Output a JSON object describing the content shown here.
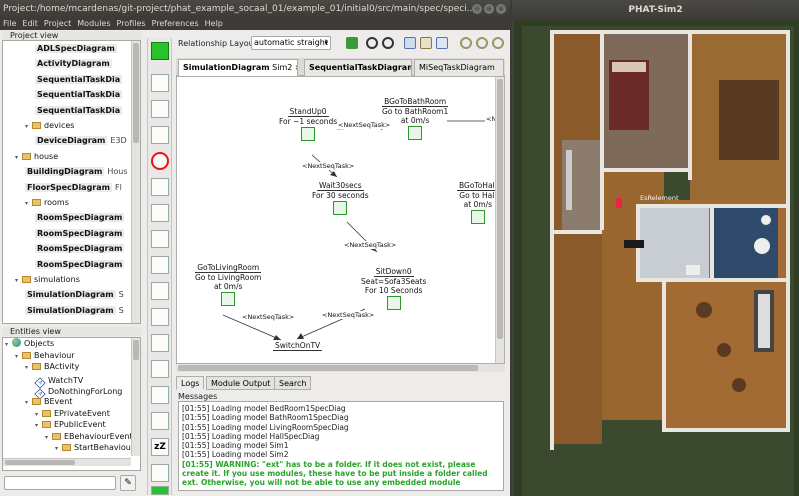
{
  "editor": {
    "title": "Project:/home/mcardenas/git-project/phat_example_socaal_01/example_01/initial0/src/main/spec/speci...",
    "window_buttons": [
      "⊖",
      "⊕",
      "⊗"
    ],
    "menu": [
      "File",
      "Edit",
      "Project",
      "Modules",
      "Profiles",
      "Preferences",
      "Help"
    ]
  },
  "project_view": {
    "title": "Project view",
    "rows": [
      {
        "label": "ADLSpecDiagram",
        "suffix": "",
        "indent": 3,
        "bold": true,
        "icon": "none"
      },
      {
        "label": "ActivityDiagram",
        "suffix": "",
        "indent": 3,
        "bold": true,
        "icon": "none"
      },
      {
        "label": "SequentialTaskDia",
        "suffix": "",
        "indent": 3,
        "bold": true,
        "icon": "none"
      },
      {
        "label": "SequentialTaskDia",
        "suffix": "",
        "indent": 3,
        "bold": true,
        "icon": "none"
      },
      {
        "label": "SequentialTaskDia",
        "suffix": "",
        "indent": 3,
        "bold": true,
        "icon": "none"
      },
      {
        "label": "devices",
        "suffix": "",
        "indent": 2,
        "bold": false,
        "icon": "folder"
      },
      {
        "label": "DeviceDiagram",
        "suffix": "E3D",
        "indent": 3,
        "bold": true,
        "icon": "none"
      },
      {
        "label": "house",
        "suffix": "",
        "indent": 1,
        "bold": false,
        "icon": "folder"
      },
      {
        "label": "BuildingDiagram",
        "suffix": "Hous",
        "indent": 2,
        "bold": true,
        "icon": "none"
      },
      {
        "label": "FloorSpecDiagram",
        "suffix": "Fl",
        "indent": 2,
        "bold": true,
        "icon": "none"
      },
      {
        "label": "rooms",
        "suffix": "",
        "indent": 2,
        "bold": false,
        "icon": "folder"
      },
      {
        "label": "RoomSpecDiagram",
        "suffix": "",
        "indent": 3,
        "bold": true,
        "icon": "none"
      },
      {
        "label": "RoomSpecDiagram",
        "suffix": "",
        "indent": 3,
        "bold": true,
        "icon": "none"
      },
      {
        "label": "RoomSpecDiagram",
        "suffix": "",
        "indent": 3,
        "bold": true,
        "icon": "none"
      },
      {
        "label": "RoomSpecDiagram",
        "suffix": "",
        "indent": 3,
        "bold": true,
        "icon": "none"
      },
      {
        "label": "simulations",
        "suffix": "",
        "indent": 1,
        "bold": false,
        "icon": "folder"
      },
      {
        "label": "SimulationDiagram",
        "suffix": "S",
        "indent": 2,
        "bold": true,
        "icon": "none"
      },
      {
        "label": "SimulationDiagram",
        "suffix": "S",
        "indent": 2,
        "bold": true,
        "icon": "none"
      }
    ]
  },
  "entities_view": {
    "title": "Entities view",
    "rows": [
      {
        "label": "Objects",
        "indent": 0,
        "icon": "globe"
      },
      {
        "label": "Behaviour",
        "indent": 1,
        "icon": "folder"
      },
      {
        "label": "BActivity",
        "indent": 2,
        "icon": "folder"
      },
      {
        "label": "WatchTV",
        "indent": 3,
        "icon": "diamond"
      },
      {
        "label": "DoNothingForLong",
        "indent": 3,
        "icon": "diamond"
      },
      {
        "label": "BEvent",
        "indent": 2,
        "icon": "folder"
      },
      {
        "label": "EPrivateEvent",
        "indent": 3,
        "icon": "folder"
      },
      {
        "label": "EPublicEvent",
        "indent": 3,
        "icon": "folder"
      },
      {
        "label": "EBehaviourEvent",
        "indent": 4,
        "icon": "folder"
      },
      {
        "label": "StartBehaviourE",
        "indent": 5,
        "icon": "folder"
      }
    ],
    "search_placeholder": ""
  },
  "toolbar": {
    "layout_label": "Relationship Layout",
    "layout_value": "automatic straight"
  },
  "tabs": [
    {
      "label": "SimulationDiagram",
      "extra": "Sim2",
      "active": true
    },
    {
      "label": "SequentialTaskDiagram",
      "extra": "",
      "active": false
    },
    {
      "label": "MiSeqTaskDiagram",
      "extra": "",
      "active": false
    }
  ],
  "diagram": {
    "nodes": [
      {
        "title": "StandUp0",
        "line2": "For ~1 seconds",
        "line3": ""
      },
      {
        "title": "BGoToBathRoom",
        "line2": "Go to BathRoom1",
        "line3": "at 0m/s"
      },
      {
        "title": "Wait30secs",
        "line2": "For 30 seconds",
        "line3": ""
      },
      {
        "title": "BGoToHall",
        "line2": "Go to Hall",
        "line3": "at 0m/s"
      },
      {
        "title": "SitDown0",
        "line2": "Seat=Sofa3Seats",
        "line3": "For 10 Seconds"
      },
      {
        "title": "GoToLivingRoom",
        "line2": "Go to LivingRoom",
        "line3": "at 0m/s"
      },
      {
        "title": "SwitchOnTV",
        "line2": "",
        "line3": ""
      }
    ],
    "edge_label": "<NextSeqTask>",
    "edge_label_right": "<Ne"
  },
  "log_tabs": [
    "Logs",
    "Module Output",
    "Search"
  ],
  "messages_title": "Messages",
  "log_lines": [
    "[01:55] Loading model BedRoom1SpecDiag",
    "[01:55] Loading model BathRoom1SpecDiag",
    "[01:55] Loading model LivingRoomSpecDiag",
    "[01:55] Loading model HallSpecDiag",
    "[01:55] Loading model Sim1",
    "[01:55] Loading model Sim2"
  ],
  "log_warning": "[01:55] WARNING: \"ext\" has to be a folder. If it does not exist, please create it. If you use modules, these have to be put inside a folder called ext. Otherwise, you will not be able to use any embedded module",
  "sim": {
    "title": "PHAT-Sim2",
    "person_label": "EsRelement"
  }
}
